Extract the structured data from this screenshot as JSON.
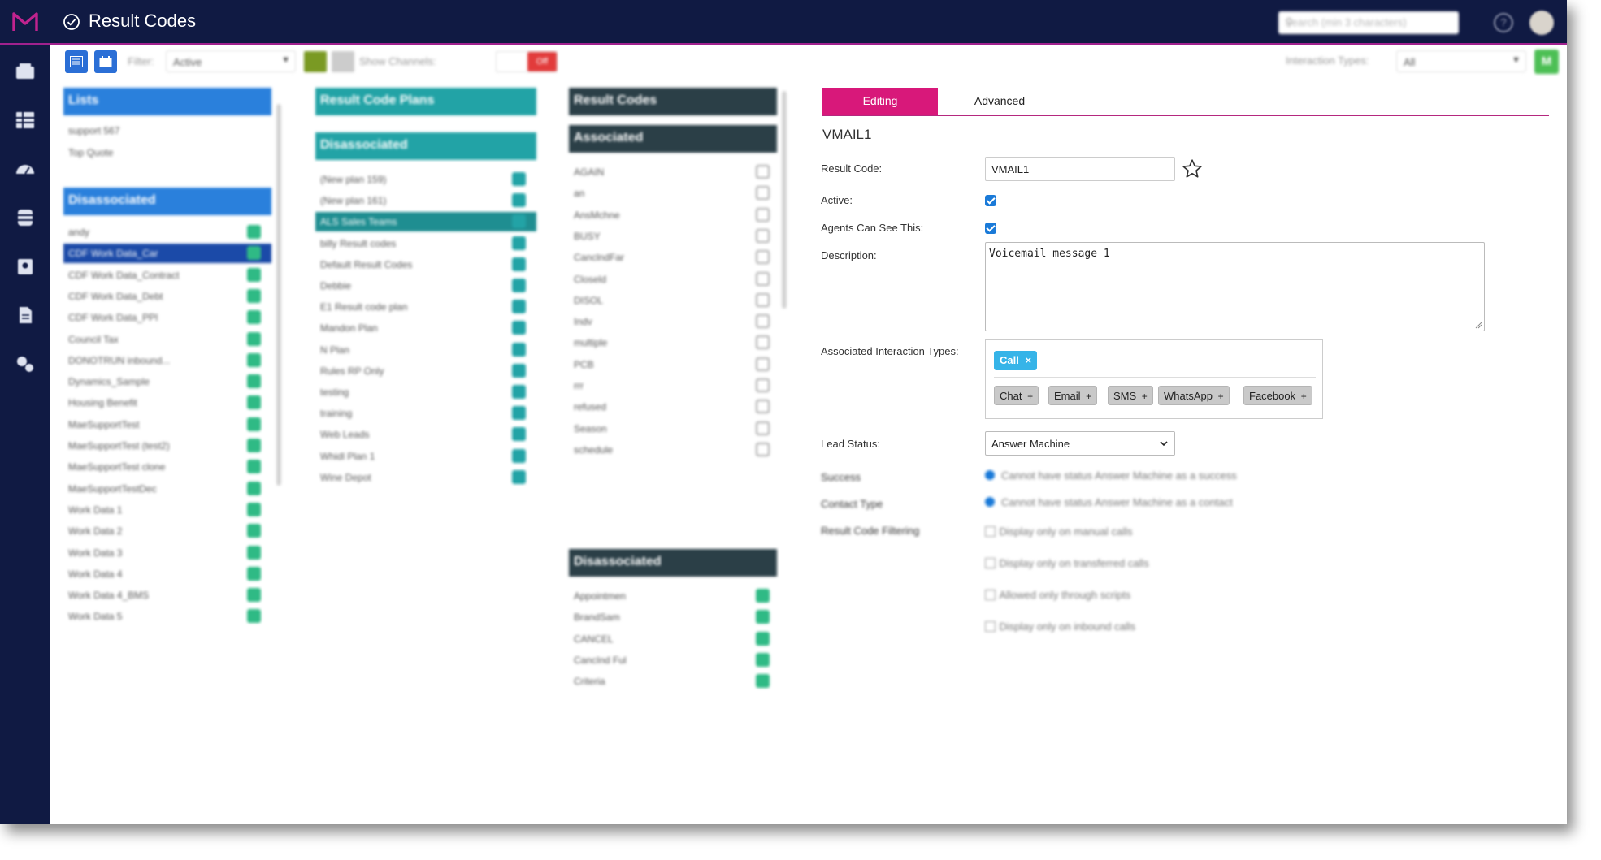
{
  "header": {
    "title": "Result Codes",
    "search_placeholder": "Search (min 3 characters)"
  },
  "toolbar": {
    "filter_label": "Filter:",
    "filter_value": "Active",
    "show_channels_label": "Show Channels:",
    "show_channels_toggle": "Off",
    "interaction_types_label": "Interaction Types:",
    "interaction_types_value": "All",
    "export_button": "M"
  },
  "lists_panel": {
    "header": "Lists",
    "lists": [
      "support 567",
      "Top Quote"
    ],
    "disassociated_header": "Disassociated",
    "items": [
      "andy",
      "CDF Work Data_Car",
      "CDF Work Data_Contract",
      "CDF Work Data_Debt",
      "CDF Work Data_PPI",
      "Council Tax",
      "DONOTRUN inbound...",
      "Dynamics_Sample",
      "Housing Benefit",
      "MaeSupportTest",
      "MaeSupportTest (test2)",
      "MaeSupportTest clone",
      "MaeSupportTestDec",
      "Work Data 1",
      "Work Data 2",
      "Work Data 3",
      "Work Data 4",
      "Work Data 4_BMS",
      "Work Data 5"
    ],
    "selected_index": 1
  },
  "plans_panel": {
    "header": "Result Code Plans",
    "disassociated_header": "Disassociated",
    "items": [
      "(New plan 159)",
      "(New plan 161)",
      "ALS Sales Teams",
      "billy Result codes",
      "Default Result Codes",
      "Debbie",
      "E1 Result code plan",
      "Mandon Plan",
      "N Plan",
      "Rules RP Only",
      "testing",
      "training",
      "Web Leads",
      "Whidl Plan 1",
      "Wine Depot"
    ],
    "selected_index": 2
  },
  "codes_panel": {
    "header": "Result Codes",
    "associated_header": "Associated",
    "associated_items": [
      "AGAIN",
      "an",
      "AnsMchne",
      "BUSY",
      "CanclndFar",
      "Closeld",
      "DISOL",
      "Indv",
      "multiple",
      "PCB",
      "rrr",
      "refused",
      "Season",
      "schedule"
    ],
    "disassociated_header": "Disassociated",
    "disassociated_items": [
      "Appointmen",
      "BrandSam",
      "CANCEL",
      "CancInd Ful",
      "Criteria"
    ]
  },
  "editor": {
    "tabs": [
      "Editing",
      "Advanced"
    ],
    "active_tab": "Editing",
    "record_title": "VMAIL1",
    "fields": {
      "result_code_label": "Result Code:",
      "result_code_value": "VMAIL1",
      "active_label": "Active:",
      "active_checked": true,
      "agents_label": "Agents Can See This:",
      "agents_checked": true,
      "description_label": "Description:",
      "description_value": "Voicemail message 1",
      "interaction_types_label": "Associated Interaction Types:",
      "selected_types": [
        "Call"
      ],
      "available_types": [
        "Chat",
        "Email",
        "SMS",
        "WhatsApp",
        "Facebook"
      ],
      "lead_status_label": "Lead Status:",
      "lead_status_value": "Answer Machine",
      "success_label": "Success",
      "success_text": "Cannot have status Answer Machine as a success",
      "contact_type_label": "Contact Type",
      "contact_type_text": "Cannot have status Answer Machine as a contact",
      "filtering_label": "Result Code Filtering",
      "filter_options": [
        "Display only on manual calls",
        "Display only on transferred calls",
        "Allowed only through scripts",
        "Display only on inbound calls"
      ]
    }
  },
  "colors": {
    "topbar": "#101a43",
    "accent": "#d8187a",
    "lists_header": "#2a80dc",
    "plans_header": "#22a3a6",
    "codes_header": "#2b3f47",
    "badge": "#36b4e8"
  }
}
